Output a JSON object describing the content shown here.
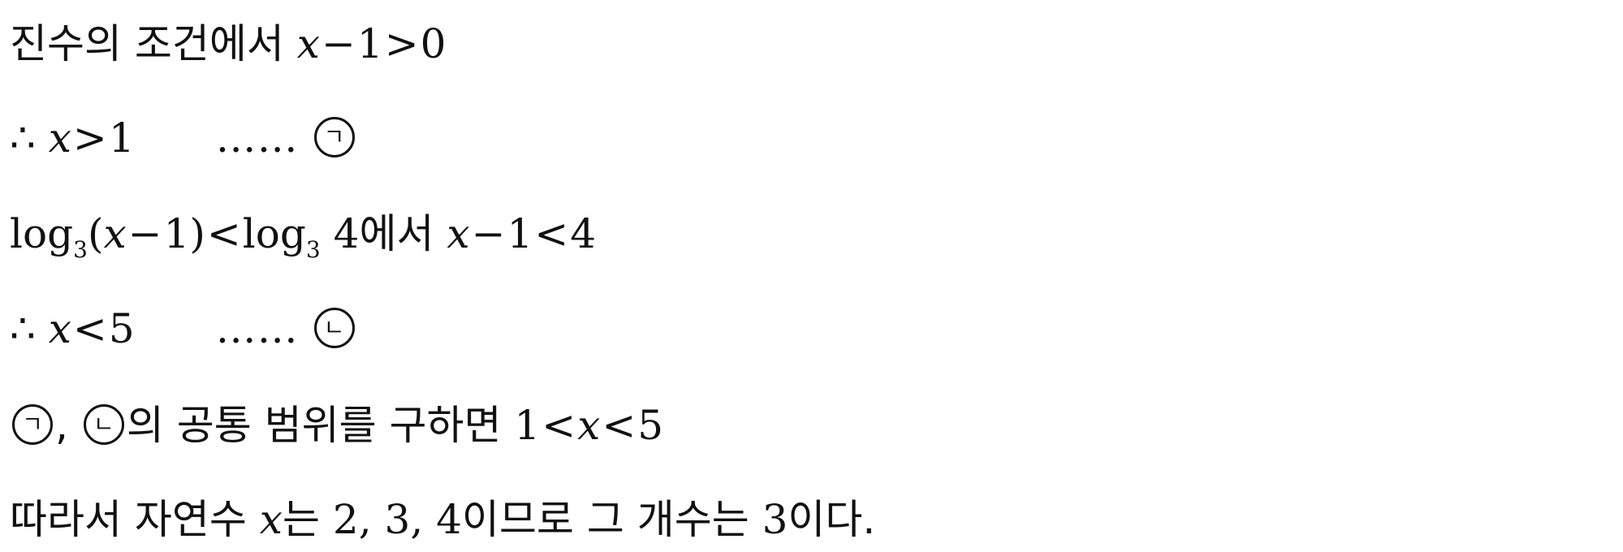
{
  "lines": [
    {
      "text_a": "진수의 조건에서 ",
      "var_x": "x",
      "minus": "−",
      "one": "1",
      "gt": ">",
      "zero": "0"
    },
    {
      "therefore": "∴",
      "var_x": "x",
      "gt": ">",
      "one": "1",
      "dots": "……",
      "marker": "ㄱ"
    },
    {
      "log": "log",
      "base": "3",
      "lparen": "(",
      "var_x": "x",
      "minus": "−",
      "one": "1",
      "rparen": ")",
      "lt": "<",
      "log2": "log",
      "base2": "3",
      "four": "4",
      "text_a": "에서 ",
      "var_x2": "x",
      "minus2": "−",
      "one2": "1",
      "lt2": "<",
      "four2": "4"
    },
    {
      "therefore": "∴",
      "var_x": "x",
      "lt": "<",
      "five": "5",
      "dots": "……",
      "marker": "ㄴ"
    },
    {
      "marker1": "ㄱ",
      "comma": ",",
      "marker2": "ㄴ",
      "text_a": "의 공통 범위를 구하면 ",
      "one": "1",
      "lt": "<",
      "var_x": "x",
      "lt2": "<",
      "five": "5"
    },
    {
      "text_a": "따라서 자연수 ",
      "var_x": "x",
      "text_b": "는 ",
      "nums": "2, 3, 4",
      "text_c": "이므로 그 개수는 ",
      "three": "3",
      "text_d": "이다."
    }
  ]
}
